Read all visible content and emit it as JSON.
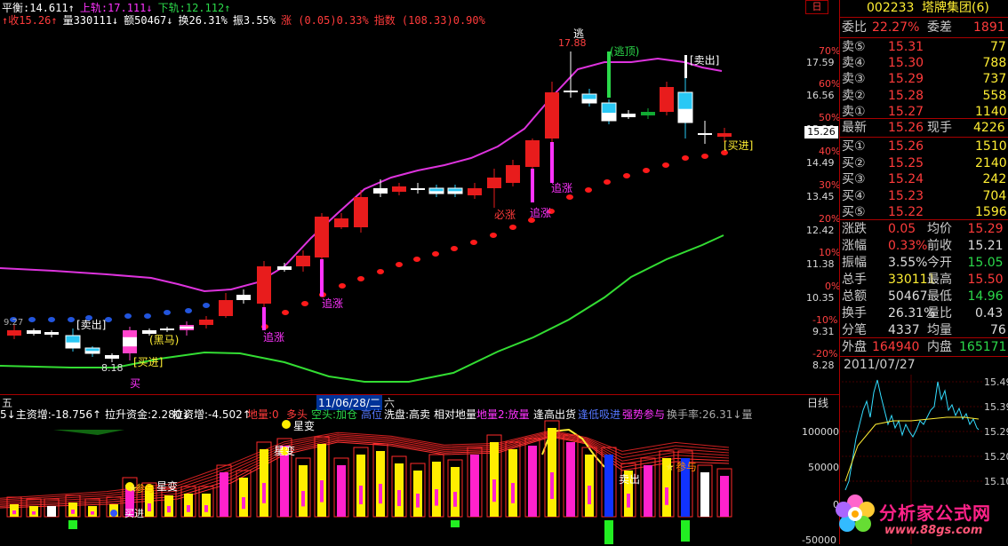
{
  "header": {
    "line1": [
      {
        "text": "平衡:14.611↑",
        "color": "#ffffff"
      },
      {
        "text": "上轨:17.111↓",
        "color": "#ff33ff"
      },
      {
        "text": "下轨:12.112↑",
        "color": "#2bd94a"
      }
    ],
    "line2": [
      {
        "text": "↑收15.26↑",
        "color": "#ff3b3b"
      },
      {
        "text": "量330111↓",
        "color": "#ffffff"
      },
      {
        "text": "额50467↓",
        "color": "#ffffff"
      },
      {
        "text": "换26.31%",
        "color": "#ffffff"
      },
      {
        "text": "振3.55%",
        "color": "#ffffff"
      },
      {
        "text": "涨 (0.05)0.33%",
        "color": "#ff3b3b"
      },
      {
        "text": "指数 (108.33)0.90%",
        "color": "#ff3b3b"
      }
    ],
    "top_right_tag": "日"
  },
  "price_axis": {
    "pct": [
      "70%",
      "60%",
      "50%",
      "40%",
      "30%",
      "20%",
      "10%",
      "0%",
      "-10%",
      "-20%"
    ],
    "prices": [
      "17.59",
      "16.56",
      "15.26",
      "14.49",
      "13.45",
      "12.42",
      "11.38",
      "10.35",
      "9.31",
      "8.28"
    ],
    "current_price": "15.26"
  },
  "chart_annotations": {
    "tao": "逃",
    "tao_price": "17.88",
    "tao_ding": "(逃顶)",
    "sell_out_1": "[卖出]",
    "sell_out_2": "[卖出]",
    "buy_in_1": "[买进]",
    "buy_in_2": "[买进]",
    "black_horse": "(黑马)",
    "zhui_zhang": [
      "追涨",
      "追涨",
      "追涨",
      "追涨"
    ],
    "bi_zhang": "必涨",
    "low_price": "9.27",
    "ticks_small": "8.18",
    "bottom_mark": "买"
  },
  "date_bar": {
    "left": "五",
    "date": "11/06/28/二",
    "right": "六",
    "period": "日线"
  },
  "indicator_bar": [
    {
      "text": "5↓主资增:-18.756↑",
      "color": "#ffffff"
    },
    {
      "text": "拉升资金:2.280↓",
      "color": "#ffffff"
    },
    {
      "text": "拉资增:-4.502↑",
      "color": "#ffffff"
    },
    {
      "text": "地量:0",
      "color": "#ff3b3b"
    },
    {
      "text": "多头",
      "color": "#ff3b3b"
    },
    {
      "text": "空头:加仓",
      "color": "#2bd94a"
    },
    {
      "text": "高位",
      "color": "#5577ff"
    },
    {
      "text": "洗盘:高卖",
      "color": "#ffffff"
    },
    {
      "text": "相对地量",
      "color": "#ffffff"
    },
    {
      "text": "地量2:放量",
      "color": "#ff33ff"
    },
    {
      "text": "逢高出货",
      "color": "#ffffff"
    },
    {
      "text": "逢低吸进",
      "color": "#5577ff"
    },
    {
      "text": "强势参与",
      "color": "#ff33ff"
    },
    {
      "text": "换手率:26.31↓量",
      "color": "#aaaaaa"
    }
  ],
  "indicator_labels": {
    "xing_bian_1": "星变",
    "xing_bian_2": "星变",
    "xing_bian_3": "星变",
    "can_yu_1": "参与",
    "can_yu_2": "参与",
    "mai_chu": "卖出",
    "mai_jin": "买进"
  },
  "volume_axis": [
    "100000",
    "50000",
    "0",
    "-50000"
  ],
  "quote": {
    "code": "002233",
    "name": "塔牌集团(6)",
    "weibi_label": "委比",
    "weibi_value": "22.27%",
    "weicha_label": "委差",
    "weicha_value": "1891",
    "asks": [
      {
        "label": "卖⑤",
        "price": "15.31",
        "vol": "77"
      },
      {
        "label": "卖④",
        "price": "15.30",
        "vol": "788"
      },
      {
        "label": "卖③",
        "price": "15.29",
        "vol": "737"
      },
      {
        "label": "卖②",
        "price": "15.28",
        "vol": "558"
      },
      {
        "label": "卖①",
        "price": "15.27",
        "vol": "1140"
      }
    ],
    "last": {
      "label": "最新",
      "price": "15.26",
      "label2": "现手",
      "vol": "4226"
    },
    "bids": [
      {
        "label": "买①",
        "price": "15.26",
        "vol": "1510"
      },
      {
        "label": "买②",
        "price": "15.25",
        "vol": "2140"
      },
      {
        "label": "买③",
        "price": "15.24",
        "vol": "242"
      },
      {
        "label": "买④",
        "price": "15.23",
        "vol": "704"
      },
      {
        "label": "买⑤",
        "price": "15.22",
        "vol": "1596"
      }
    ],
    "stats": [
      {
        "l1": "涨跌",
        "v1": "0.05",
        "c1": "#ff3b3b",
        "l2": "均价",
        "v2": "15.29",
        "c2": "#ff3b3b"
      },
      {
        "l1": "涨幅",
        "v1": "0.33%",
        "c1": "#ff3b3b",
        "l2": "前收",
        "v2": "15.21",
        "c2": "#dddddd"
      },
      {
        "l1": "振幅",
        "v1": "3.55%",
        "c1": "#dddddd",
        "l2": "今开",
        "v2": "15.05",
        "c2": "#2bd94a"
      },
      {
        "l1": "总手",
        "v1": "330111",
        "c1": "#ffee33",
        "l2": "最高",
        "v2": "15.50",
        "c2": "#ff3b3b"
      },
      {
        "l1": "总额",
        "v1": "50467",
        "c1": "#dddddd",
        "l2": "最低",
        "v2": "14.96",
        "c2": "#2bd94a"
      },
      {
        "l1": "换手",
        "v1": "26.31%",
        "c1": "#dddddd",
        "l2": "量比",
        "v2": "0.43",
        "c2": "#dddddd"
      },
      {
        "l1": "分笔",
        "v1": "4337",
        "c1": "#dddddd",
        "l2": "均量",
        "v2": "76",
        "c2": "#dddddd"
      }
    ],
    "waipan_label": "外盘",
    "waipan_value": "164940",
    "neipan_label": "内盘",
    "neipan_value": "165171",
    "date": "2011/07/27",
    "intraday_prices": [
      "15.49",
      "15.39",
      "15.29",
      "15.20",
      "15.10"
    ]
  },
  "watermark": {
    "site": "分析家公式网",
    "url": "www.88gs.com"
  },
  "colors": {
    "up": "#ff3b3b",
    "down": "#2bd94a",
    "upper_band": "#dd33dd",
    "lower_band": "#33dd33",
    "sar_dots": "#ff1a1a",
    "divider": "#aa0000"
  }
}
